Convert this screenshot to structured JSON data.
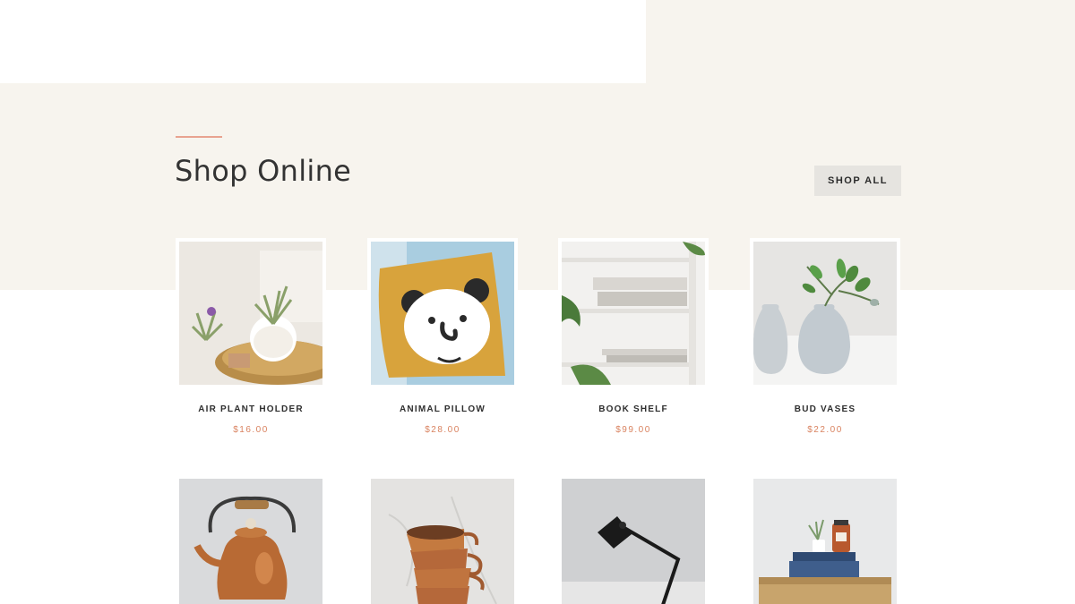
{
  "section": {
    "title": "Shop Online",
    "shop_all_label": "SHOP ALL"
  },
  "products": [
    {
      "name": "AIR PLANT HOLDER",
      "price": "$16.00"
    },
    {
      "name": "ANIMAL PILLOW",
      "price": "$28.00"
    },
    {
      "name": "BOOK SHELF",
      "price": "$99.00"
    },
    {
      "name": "BUD VASES",
      "price": "$22.00"
    }
  ],
  "colors": {
    "background": "#f7f4ee",
    "accent": "#e8a390",
    "price": "#d9825f",
    "button_bg": "#e6e4e0"
  }
}
